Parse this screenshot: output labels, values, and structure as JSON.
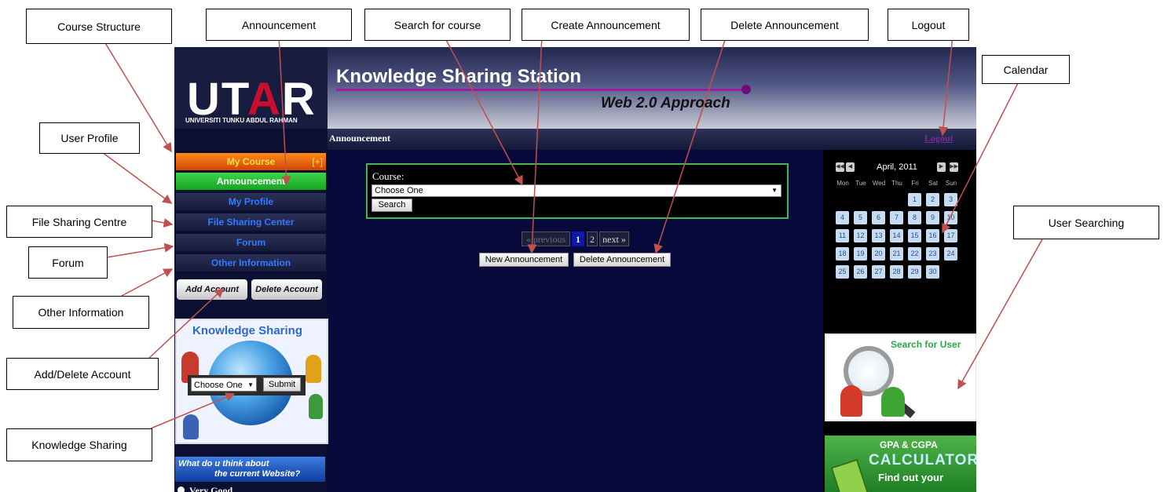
{
  "app": {
    "logo_text_left": "UT",
    "logo_text_a": "A",
    "logo_text_right": "R",
    "logo_subtitle": "UNIVERSITI TUNKU ABDUL RAHMAN",
    "site_title": "Knowledge Sharing Station",
    "site_subtitle": "Web 2.0 Approach",
    "breadcrumb": "Announcement",
    "logout": "Logout"
  },
  "sidebar": {
    "items": [
      {
        "label": "My Course",
        "expand": "[+]"
      },
      {
        "label": "Announcement"
      },
      {
        "label": "My Profile"
      },
      {
        "label": "File Sharing Center"
      },
      {
        "label": "Forum"
      },
      {
        "label": "Other Information"
      }
    ],
    "add_account": "Add Account",
    "delete_account": "Delete Account"
  },
  "knowledge_sharing": {
    "title": "Knowledge Sharing",
    "select_value": "Choose One",
    "submit": "Submit"
  },
  "poll": {
    "line1": "What do u think about",
    "line2": "the current Website?",
    "option1": "Very Good"
  },
  "main": {
    "course_label": "Course:",
    "course_select": "Choose One",
    "search_button": "Search",
    "pager": {
      "prev": "« previous",
      "page1": "1",
      "page2": "2",
      "next": "next »",
      "current_page": 1
    },
    "new_announcement": "New Announcement",
    "delete_announcement": "Delete Announcement"
  },
  "calendar": {
    "title": "April, 2011",
    "weekdays": [
      "Mon",
      "Tue",
      "Wed",
      "Thu",
      "Fri",
      "Sat",
      "Sun"
    ],
    "days": [
      "1",
      "2",
      "3",
      "4",
      "5",
      "6",
      "7",
      "8",
      "9",
      "10",
      "11",
      "12",
      "13",
      "14",
      "15",
      "16",
      "17",
      "18",
      "19",
      "20",
      "21",
      "22",
      "23",
      "24",
      "25",
      "26",
      "27",
      "28",
      "29",
      "30"
    ],
    "first_weekday_index": 4
  },
  "widgets": {
    "user_search_title": "Search for User",
    "gpa_line1": "GPA & CGPA",
    "gpa_line2": "CALCULATOR",
    "gpa_line3": "Find out your"
  },
  "annotations": {
    "course_structure": "Course Structure",
    "announcement": "Announcement",
    "search_for_course": "Search for course",
    "create_announcement": "Create Announcement",
    "delete_announcement": "Delete Announcement",
    "logout": "Logout",
    "calendar": "Calendar",
    "user_profile": "User Profile",
    "file_sharing_centre": "File Sharing Centre",
    "forum": "Forum",
    "other_information": "Other Information",
    "add_delete_account": "Add/Delete Account",
    "knowledge_sharing": "Knowledge Sharing",
    "user_searching": "User Searching"
  },
  "colors": {
    "annotation_arrow": "#c0504d",
    "page_background": "#07093a",
    "active_nav": "#1ca825",
    "course_nav": "#ff6a00",
    "nav_text": "#2f7cff"
  }
}
